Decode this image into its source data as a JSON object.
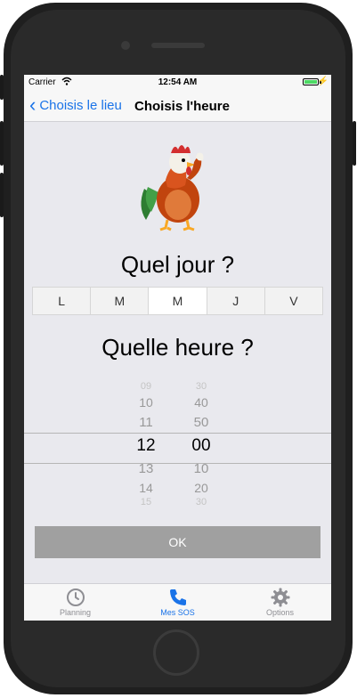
{
  "status": {
    "carrier": "Carrier",
    "time": "12:54 AM"
  },
  "nav": {
    "back_label": "Choisis le lieu",
    "title": "Choisis l'heure"
  },
  "day_section": {
    "heading": "Quel jour ?",
    "days": [
      "L",
      "M",
      "M",
      "J",
      "V"
    ],
    "selected_index": 2
  },
  "time_section": {
    "heading": "Quelle heure ?",
    "hours": [
      "09",
      "10",
      "11",
      "12",
      "13",
      "14",
      "15"
    ],
    "minutes": [
      "30",
      "40",
      "50",
      "00",
      "10",
      "20",
      "30"
    ],
    "selected_hour": "12",
    "selected_minute": "00"
  },
  "ok_label": "OK",
  "tabs": [
    {
      "label": "Planning",
      "icon": "clock-icon",
      "active": false
    },
    {
      "label": "Mes SOS",
      "icon": "phone-icon",
      "active": true
    },
    {
      "label": "Options",
      "icon": "gear-icon",
      "active": false
    }
  ],
  "colors": {
    "accent": "#1a73e8",
    "ok_button": "#a0a0a0",
    "background": "#e9e9ee"
  }
}
